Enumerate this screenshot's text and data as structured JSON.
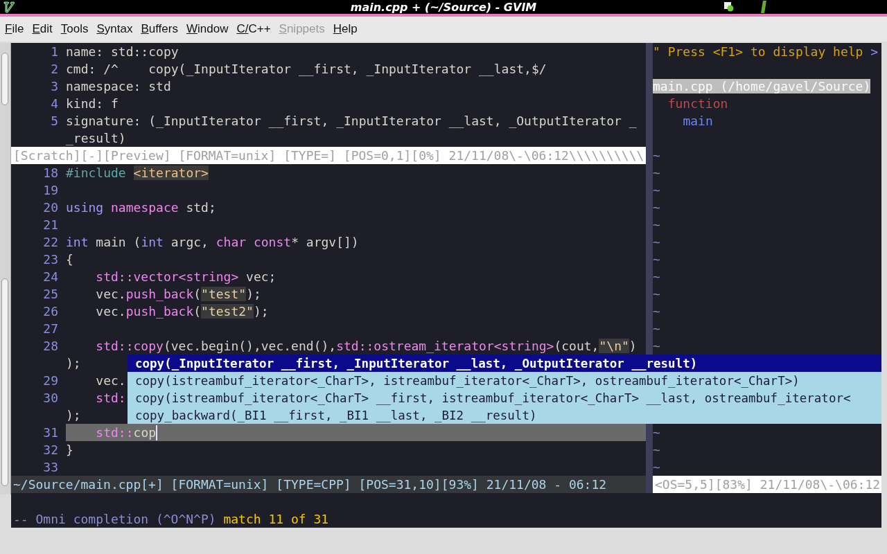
{
  "window": {
    "title": "main.cpp + (~/Source) - GVIM"
  },
  "menu": [
    {
      "label": "File",
      "disabled": false
    },
    {
      "label": "Edit",
      "disabled": false
    },
    {
      "label": "Tools",
      "disabled": false
    },
    {
      "label": "Syntax",
      "disabled": false
    },
    {
      "label": "Buffers",
      "disabled": false
    },
    {
      "label": "Window",
      "disabled": false
    },
    {
      "label": "C/C++",
      "disabled": false
    },
    {
      "label": "Snippets",
      "disabled": true
    },
    {
      "label": "Help",
      "disabled": false
    }
  ],
  "preview": {
    "lines": [
      {
        "number": "1",
        "segments": [
          {
            "text": "name: std::copy",
            "kind": "plain"
          }
        ]
      },
      {
        "number": "2",
        "segments": [
          {
            "text": "cmd: /^    copy(_InputIterator __first, _InputIterator __last,$/",
            "kind": "plain"
          }
        ]
      },
      {
        "number": "3",
        "segments": [
          {
            "text": "namespace: std",
            "kind": "plain"
          }
        ]
      },
      {
        "number": "4",
        "segments": [
          {
            "text": "kind: f",
            "kind": "plain"
          }
        ]
      },
      {
        "number": "5",
        "segments": [
          {
            "text": "signature: (_InputIterator __first, _InputIterator __last, _OutputIterator _",
            "kind": "plain"
          }
        ]
      },
      {
        "segments": [
          {
            "text": "_result)",
            "kind": "plain"
          }
        ]
      }
    ],
    "status": {
      "text": "[Scratch][-][Preview] [FORMAT=unix] [TYPE=] [POS=0,1][0%] 21/11/08\\-\\06:12\\\\\\\\\\\\\\\\\\\\",
      "active": false
    }
  },
  "editor": {
    "lines": [
      {
        "number": "18",
        "current": false,
        "segments": [
          {
            "text": "#include ",
            "kind": "preproc"
          },
          {
            "text": "<iterator>",
            "kind": "include"
          }
        ]
      },
      {
        "number": "19",
        "current": false
      },
      {
        "number": "20",
        "current": false,
        "segments": [
          {
            "text": "using ",
            "kind": "type"
          },
          {
            "text": "namespace",
            "kind": "keyword"
          },
          {
            "text": " std;",
            "kind": "plain"
          }
        ]
      },
      {
        "number": "21",
        "current": false
      },
      {
        "number": "22",
        "current": false,
        "segments": [
          {
            "text": "int",
            "kind": "type"
          },
          {
            "text": " main (",
            "kind": "plain"
          },
          {
            "text": "int",
            "kind": "type"
          },
          {
            "text": " argc, ",
            "kind": "plain"
          },
          {
            "text": "char const",
            "kind": "keyword"
          },
          {
            "text": "* argv[])",
            "kind": "plain"
          }
        ]
      },
      {
        "number": "23",
        "current": false,
        "segments": [
          {
            "text": "{",
            "kind": "plain"
          }
        ]
      },
      {
        "number": "24",
        "current": false,
        "segments": [
          {
            "text": "    std::vector<string>",
            "kind": "keyword"
          },
          {
            "text": " vec;",
            "kind": "plain"
          }
        ]
      },
      {
        "number": "25",
        "current": false,
        "segments": [
          {
            "text": "    vec.",
            "kind": "plain"
          },
          {
            "text": "push_back",
            "kind": "keyword"
          },
          {
            "text": "(",
            "kind": "plain"
          },
          {
            "text": "\"test\"",
            "kind": "string"
          },
          {
            "text": ");",
            "kind": "plain"
          }
        ]
      },
      {
        "number": "26",
        "current": false,
        "segments": [
          {
            "text": "    vec.",
            "kind": "plain"
          },
          {
            "text": "push_back",
            "kind": "keyword"
          },
          {
            "text": "(",
            "kind": "plain"
          },
          {
            "text": "\"test2\"",
            "kind": "string"
          },
          {
            "text": ");",
            "kind": "plain"
          }
        ]
      },
      {
        "number": "27",
        "current": false
      },
      {
        "number": "28",
        "current": false,
        "segments": [
          {
            "text": "    std::copy",
            "kind": "keyword"
          },
          {
            "text": "(vec.begin(),vec.end(),",
            "kind": "plain"
          },
          {
            "text": "std::ostream_iterator<string>",
            "kind": "keyword"
          },
          {
            "text": "(cout,",
            "kind": "plain"
          },
          {
            "text": "\"\\n\"",
            "kind": "string"
          },
          {
            "text": ")",
            "kind": "plain"
          }
        ]
      },
      {
        "current": false,
        "segments": [
          {
            "text": ");",
            "kind": "plain"
          }
        ]
      },
      {
        "number": "29",
        "current": false,
        "segments": [
          {
            "text": "    vec.",
            "kind": "plain"
          }
        ]
      },
      {
        "number": "30",
        "current": false,
        "segments": [
          {
            "text": "    std:",
            "kind": "keyword"
          }
        ]
      },
      {
        "current": false,
        "segments": [
          {
            "text": ");",
            "kind": "plain"
          }
        ]
      },
      {
        "number": "31",
        "current": true,
        "segments": [
          {
            "text": "    std::",
            "kind": "keyword"
          },
          {
            "text": "cop",
            "kind": "plain"
          }
        ]
      },
      {
        "number": "32",
        "current": false,
        "segments": [
          {
            "text": "}",
            "kind": "plain"
          }
        ]
      },
      {
        "number": "33",
        "current": false
      }
    ],
    "status": {
      "text": "~/Source/main.cpp[+] [FORMAT=unix] [TYPE=CPP] [POS=31,10][93%] 21/11/08 - 06:12",
      "active": true
    }
  },
  "tagbar": {
    "help": [
      {
        "text": "\" Press <F1> to display help ",
        "kind": "comment"
      },
      {
        "text": ">",
        "kind": "fold"
      }
    ],
    "tree": [
      {
        "text": "main.cpp (/home/gavel/Source)",
        "kind": "file",
        "selected": true,
        "children": [
          {
            "text": "function",
            "kind": "group",
            "selected": false,
            "children": [
              {
                "text": "main",
                "kind": "tag",
                "selected": false
              }
            ]
          }
        ]
      }
    ],
    "filler_top": [
      "~",
      "~",
      "~",
      "~",
      "~",
      "~",
      "~",
      "~",
      "~",
      "~",
      "~",
      "~"
    ],
    "filler_bottom": [
      "~",
      "~",
      "~"
    ],
    "status": {
      "text": "<OS=5,5][83%] 21/11/08\\-\\06:12",
      "active": false
    }
  },
  "completion": {
    "items": [
      {
        "text": "copy(_InputIterator __first, _InputIterator __last, _OutputIterator __result)",
        "selected": true
      },
      {
        "text": "copy(istreambuf_iterator<_CharT>, istreambuf_iterator<_CharT>, ostreambuf_iterator<_CharT>)",
        "selected": false
      },
      {
        "text": "copy(istreambuf_iterator<_CharT> __first, istreambuf_iterator<_CharT> __last, ostreambuf_iterator<",
        "selected": false
      },
      {
        "text": "copy_backward(_BI1 __first, _BI1 __last, _BI2 __result)",
        "selected": false
      }
    ]
  },
  "command_line": [
    {
      "text": "-- Omni completion (^O^N^P)",
      "kind": "mode"
    },
    {
      "text": " match 11 of 31",
      "kind": "match"
    }
  ]
}
